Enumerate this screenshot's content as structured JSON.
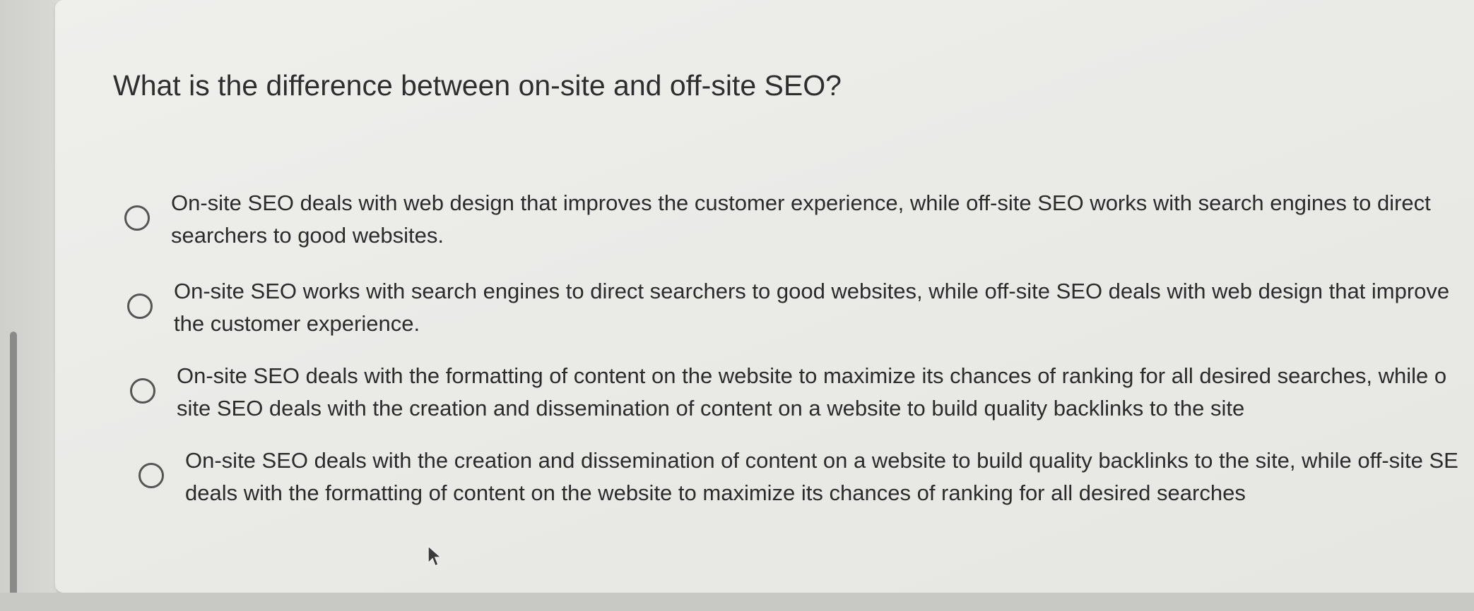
{
  "question": {
    "text": "What is the difference between on-site and off-site SEO?"
  },
  "options": [
    {
      "line1": "On-site SEO deals with web design that improves the customer experience, while off-site SEO works with search engines to direct",
      "line2": "searchers to good websites.",
      "selected": false
    },
    {
      "line1": "On-site SEO works with search engines to direct searchers to good websites, while off-site SEO deals with web design that improve",
      "line2": "the customer experience.",
      "selected": false
    },
    {
      "line1": "On-site SEO deals with the formatting of content on the website to maximize its chances of ranking for all desired searches, while o",
      "line2": "site SEO deals with the creation and dissemination of content on a website to build quality backlinks to the site",
      "selected": false
    },
    {
      "line1": "On-site SEO deals with the creation and dissemination of content on a website to build quality backlinks to the site, while off-site SE",
      "line2": "deals with the formatting of content on the website to maximize its chances of ranking for all desired searches",
      "selected": false
    }
  ],
  "icons": {
    "radio": "radio-circle-icon",
    "cursor": "mouse-pointer-icon"
  },
  "colors": {
    "text": "#2b2b2b",
    "radio_border": "#555555",
    "card_background": "#ecece9"
  }
}
